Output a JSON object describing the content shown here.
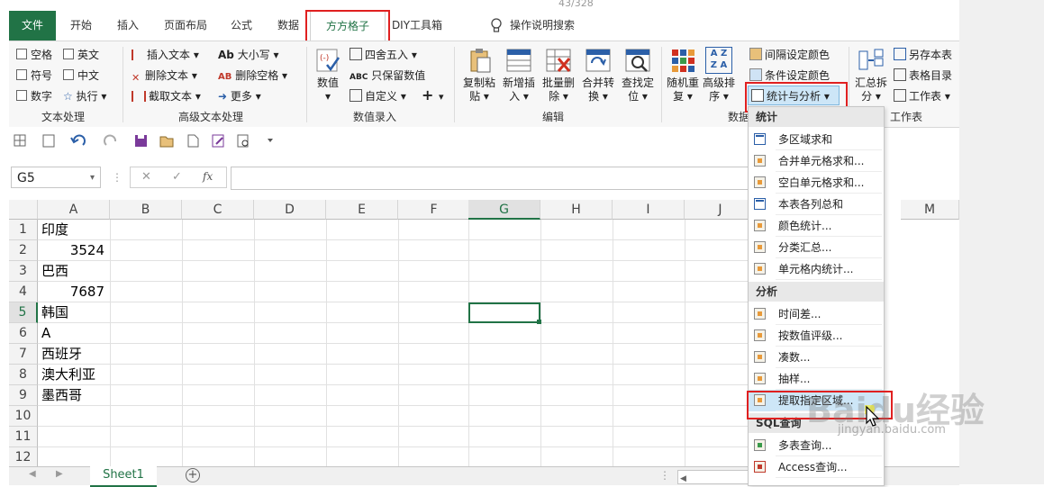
{
  "page_counter": "43/328",
  "tabs": [
    "文件",
    "开始",
    "插入",
    "页面布局",
    "公式",
    "数据",
    "方方格子",
    "DIY工具箱"
  ],
  "active_tab": "方方格子",
  "search_hint": "操作说明搜索",
  "ribbon": {
    "text_group": {
      "label": "文本处理",
      "checkboxes": [
        "空格",
        "英文",
        "符号",
        "中文",
        "数字"
      ],
      "exec": "执行"
    },
    "adv_text_group": {
      "label": "高级文本处理",
      "buttons": [
        "插入文本",
        "删除文本",
        "截取文本",
        "大小写",
        "删除空格",
        "更多"
      ],
      "case_prefix": "Ab",
      "space_prefix": "AB"
    },
    "num_group": {
      "label": "数值录入",
      "big": "数值",
      "buttons": [
        "四舍五入",
        "只保留数值",
        "自定义"
      ],
      "plus": "+",
      "abc_prefix": "ABC"
    },
    "edit_group": {
      "label": "编辑",
      "big": [
        [
          "复制粘",
          "贴"
        ],
        [
          "新增插",
          "入"
        ],
        [
          "批量删",
          "除"
        ],
        [
          "合并转",
          "换"
        ],
        [
          "查找定",
          "位"
        ]
      ]
    },
    "data_group": {
      "label": "数据",
      "big": [
        [
          "随机重",
          "复"
        ],
        [
          "高级排",
          "序"
        ]
      ],
      "sort_glyph_top": "A Z",
      "sort_glyph_bottom": "Z A",
      "buttons": [
        "间隔设定颜色",
        "条件设定颜色",
        "统计与分析"
      ]
    },
    "sheet_group": {
      "label": "工作表",
      "big": [
        "汇总拆",
        "分"
      ],
      "buttons": [
        "另存本表",
        "表格目录",
        "工作表"
      ]
    }
  },
  "formula_bar": {
    "name_box": "G5",
    "cancel": "✕",
    "confirm": "✓",
    "fx": "fx"
  },
  "columns": [
    "A",
    "B",
    "C",
    "D",
    "E",
    "F",
    "G",
    "H",
    "I",
    "J",
    "M"
  ],
  "selected_column": "G",
  "rows": [
    "1",
    "2",
    "3",
    "4",
    "5",
    "6",
    "7",
    "8",
    "9",
    "10",
    "11",
    "12"
  ],
  "selected_row": "5",
  "cells": [
    {
      "row": 1,
      "col": "A",
      "value": "印度",
      "align": "left"
    },
    {
      "row": 2,
      "col": "A",
      "value": "3524",
      "align": "right"
    },
    {
      "row": 3,
      "col": "A",
      "value": "巴西",
      "align": "left"
    },
    {
      "row": 4,
      "col": "A",
      "value": "7687",
      "align": "right"
    },
    {
      "row": 5,
      "col": "A",
      "value": "韩国",
      "align": "left"
    },
    {
      "row": 6,
      "col": "A",
      "value": "A",
      "align": "left"
    },
    {
      "row": 7,
      "col": "A",
      "value": "西班牙",
      "align": "left"
    },
    {
      "row": 8,
      "col": "A",
      "value": "澳大利亚",
      "align": "left"
    },
    {
      "row": 9,
      "col": "A",
      "value": "墨西哥",
      "align": "left"
    }
  ],
  "sheet_tab": "Sheet1",
  "menu": {
    "sections": [
      {
        "title": "统计",
        "items": [
          "多区域求和",
          "合并单元格求和...",
          "空白单元格求和...",
          "本表各列总和",
          "颜色统计...",
          "分类汇总...",
          "单元格内统计..."
        ]
      },
      {
        "title": "分析",
        "items": [
          "时间差...",
          "按数值评级...",
          "凑数...",
          "抽样...",
          "提取指定区域..."
        ]
      },
      {
        "title": "SQL查询",
        "items": [
          "多表查询...",
          "Access查询..."
        ]
      }
    ],
    "highlighted_item": "提取指定区域..."
  },
  "watermark": "Baidu经验",
  "watermark_url": "jingyan.baidu.com",
  "colors": {
    "excel_green": "#217346",
    "highlight_red": "#e02020",
    "menu_hover": "#cde6f7"
  }
}
